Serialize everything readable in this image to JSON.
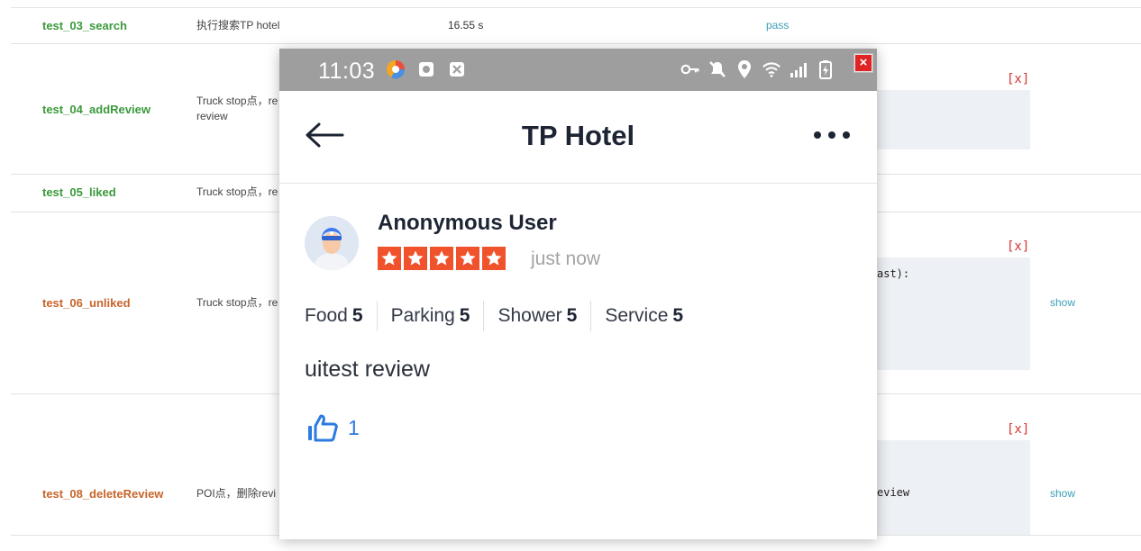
{
  "report": {
    "rows": [
      {
        "name": "test_03_search",
        "desc": "执行搜索TP hotel",
        "duration": "16.55 s",
        "status": "pass"
      },
      {
        "name": "test_04_addReview",
        "desc_line1": "Truck stop点，re",
        "desc_line2": "review",
        "error_mark": "[x]"
      },
      {
        "name": "test_05_liked",
        "desc": "Truck stop点，re"
      },
      {
        "name": "test_06_unliked",
        "desc": "Truck stop点，re",
        "error_mark": "[x]",
        "trace_fragment": "ast):",
        "show": "show"
      },
      {
        "name": "test_08_deleteReview",
        "desc": "POI点，删除revi",
        "error_mark": "[x]",
        "trace_fragment": "eview",
        "show": "show"
      }
    ]
  },
  "phone": {
    "status_bar": {
      "time": "11:03",
      "close": "×"
    },
    "title": "TP Hotel",
    "review": {
      "user": "Anonymous User",
      "stars": 5,
      "time_ago": "just now",
      "ratings": [
        {
          "label": "Food",
          "score": "5"
        },
        {
          "label": "Parking",
          "score": "5"
        },
        {
          "label": "Shower",
          "score": "5"
        },
        {
          "label": "Service",
          "score": "5"
        }
      ],
      "text": "uitest review",
      "likes": "1"
    }
  },
  "colors": {
    "pass_green": "#3a9a3a",
    "fail_orange": "#c8642a",
    "link_teal": "#3aa0b8",
    "error_red": "#d83030",
    "star_orange": "#f0522b",
    "like_blue": "#2b7be0",
    "status_bar_gray": "#9e9e9e"
  },
  "icons": [
    "back-arrow-icon",
    "more-dots-icon",
    "thumbs-up-icon",
    "star-icon",
    "avatar-icon",
    "key-icon",
    "mute-icon",
    "location-icon",
    "wifi-icon",
    "signal-icon",
    "battery-icon",
    "browser-icon",
    "notification-icon",
    "close-icon"
  ]
}
